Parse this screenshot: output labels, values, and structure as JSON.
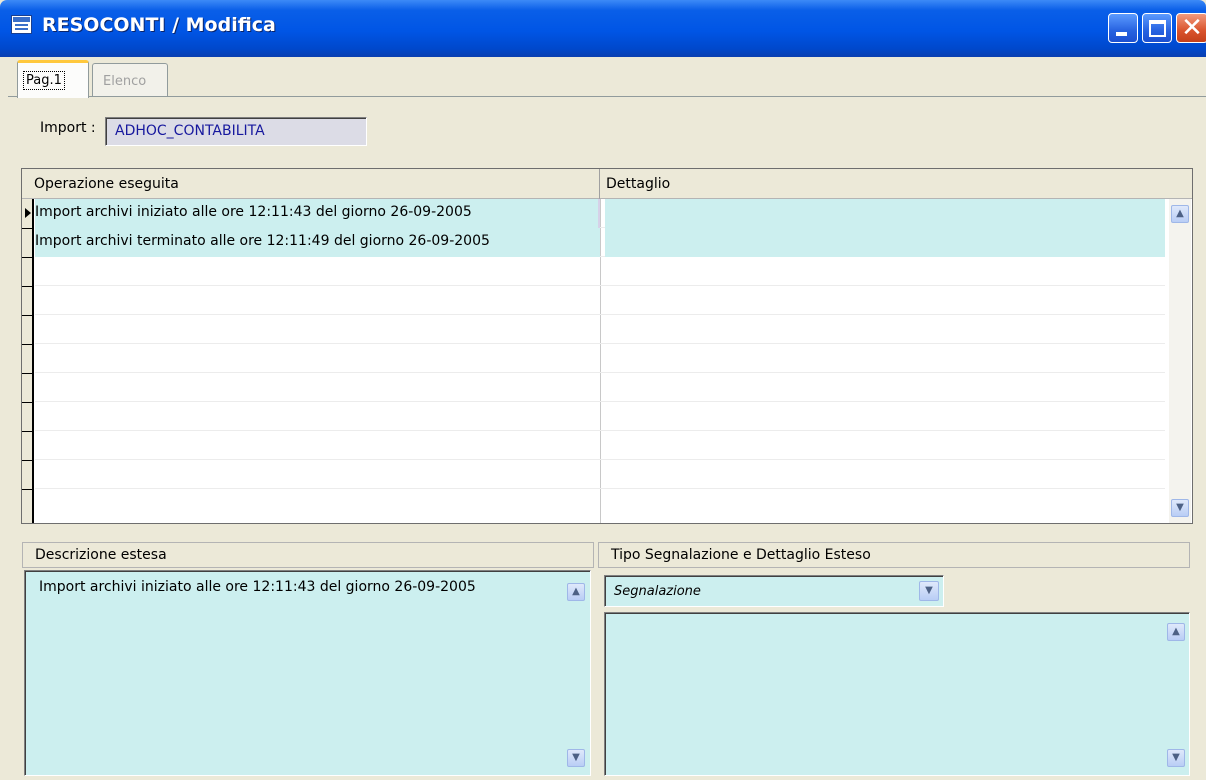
{
  "window": {
    "title": "RESOCONTI / Modifica",
    "accent_color": "#0055e5",
    "field_bg_color": "#ccefef"
  },
  "tabs": [
    {
      "label": "Pag.1",
      "active": true
    },
    {
      "label": "Elenco",
      "active": false
    }
  ],
  "import": {
    "label": "Import :",
    "value": "ADHOC_CONTABILITA"
  },
  "grid": {
    "columns": [
      "Operazione eseguita",
      "Dettaglio"
    ],
    "rows": [
      {
        "operazione": "Import archivi iniziato alle ore 12:11:43 del giorno 26-09-2005",
        "dettaglio": ""
      },
      {
        "operazione": "Import archivi terminato alle ore 12:11:49 del giorno 26-09-2005",
        "dettaglio": ""
      }
    ]
  },
  "descrizione": {
    "header": "Descrizione estesa",
    "text": "Import archivi iniziato alle ore 12:11:43 del giorno 26-09-2005"
  },
  "segnalazione": {
    "header": "Tipo Segnalazione e Dettaglio Esteso",
    "selected": "Segnalazione",
    "detail": ""
  },
  "icons": {
    "up": "▲",
    "down": "▼",
    "close": "✕"
  }
}
